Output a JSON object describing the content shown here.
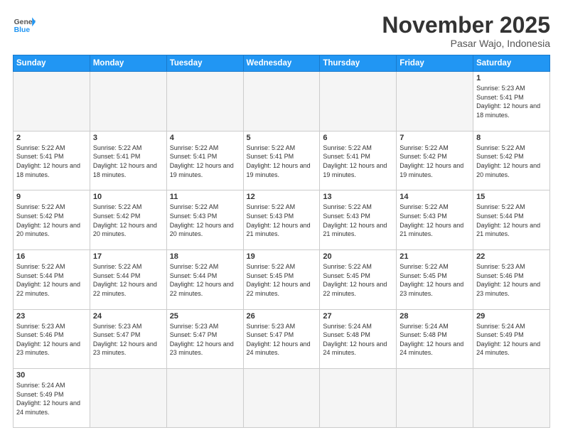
{
  "header": {
    "logo_general": "General",
    "logo_blue": "Blue",
    "month_title": "November 2025",
    "location": "Pasar Wajo, Indonesia"
  },
  "weekdays": [
    "Sunday",
    "Monday",
    "Tuesday",
    "Wednesday",
    "Thursday",
    "Friday",
    "Saturday"
  ],
  "rows": [
    [
      {
        "day": "",
        "info": ""
      },
      {
        "day": "",
        "info": ""
      },
      {
        "day": "",
        "info": ""
      },
      {
        "day": "",
        "info": ""
      },
      {
        "day": "",
        "info": ""
      },
      {
        "day": "",
        "info": ""
      },
      {
        "day": "1",
        "info": "Sunrise: 5:23 AM\nSunset: 5:41 PM\nDaylight: 12 hours and 18 minutes."
      }
    ],
    [
      {
        "day": "2",
        "info": "Sunrise: 5:22 AM\nSunset: 5:41 PM\nDaylight: 12 hours and 18 minutes."
      },
      {
        "day": "3",
        "info": "Sunrise: 5:22 AM\nSunset: 5:41 PM\nDaylight: 12 hours and 18 minutes."
      },
      {
        "day": "4",
        "info": "Sunrise: 5:22 AM\nSunset: 5:41 PM\nDaylight: 12 hours and 19 minutes."
      },
      {
        "day": "5",
        "info": "Sunrise: 5:22 AM\nSunset: 5:41 PM\nDaylight: 12 hours and 19 minutes."
      },
      {
        "day": "6",
        "info": "Sunrise: 5:22 AM\nSunset: 5:41 PM\nDaylight: 12 hours and 19 minutes."
      },
      {
        "day": "7",
        "info": "Sunrise: 5:22 AM\nSunset: 5:42 PM\nDaylight: 12 hours and 19 minutes."
      },
      {
        "day": "8",
        "info": "Sunrise: 5:22 AM\nSunset: 5:42 PM\nDaylight: 12 hours and 20 minutes."
      }
    ],
    [
      {
        "day": "9",
        "info": "Sunrise: 5:22 AM\nSunset: 5:42 PM\nDaylight: 12 hours and 20 minutes."
      },
      {
        "day": "10",
        "info": "Sunrise: 5:22 AM\nSunset: 5:42 PM\nDaylight: 12 hours and 20 minutes."
      },
      {
        "day": "11",
        "info": "Sunrise: 5:22 AM\nSunset: 5:43 PM\nDaylight: 12 hours and 20 minutes."
      },
      {
        "day": "12",
        "info": "Sunrise: 5:22 AM\nSunset: 5:43 PM\nDaylight: 12 hours and 21 minutes."
      },
      {
        "day": "13",
        "info": "Sunrise: 5:22 AM\nSunset: 5:43 PM\nDaylight: 12 hours and 21 minutes."
      },
      {
        "day": "14",
        "info": "Sunrise: 5:22 AM\nSunset: 5:43 PM\nDaylight: 12 hours and 21 minutes."
      },
      {
        "day": "15",
        "info": "Sunrise: 5:22 AM\nSunset: 5:44 PM\nDaylight: 12 hours and 21 minutes."
      }
    ],
    [
      {
        "day": "16",
        "info": "Sunrise: 5:22 AM\nSunset: 5:44 PM\nDaylight: 12 hours and 22 minutes."
      },
      {
        "day": "17",
        "info": "Sunrise: 5:22 AM\nSunset: 5:44 PM\nDaylight: 12 hours and 22 minutes."
      },
      {
        "day": "18",
        "info": "Sunrise: 5:22 AM\nSunset: 5:44 PM\nDaylight: 12 hours and 22 minutes."
      },
      {
        "day": "19",
        "info": "Sunrise: 5:22 AM\nSunset: 5:45 PM\nDaylight: 12 hours and 22 minutes."
      },
      {
        "day": "20",
        "info": "Sunrise: 5:22 AM\nSunset: 5:45 PM\nDaylight: 12 hours and 22 minutes."
      },
      {
        "day": "21",
        "info": "Sunrise: 5:22 AM\nSunset: 5:45 PM\nDaylight: 12 hours and 23 minutes."
      },
      {
        "day": "22",
        "info": "Sunrise: 5:23 AM\nSunset: 5:46 PM\nDaylight: 12 hours and 23 minutes."
      }
    ],
    [
      {
        "day": "23",
        "info": "Sunrise: 5:23 AM\nSunset: 5:46 PM\nDaylight: 12 hours and 23 minutes."
      },
      {
        "day": "24",
        "info": "Sunrise: 5:23 AM\nSunset: 5:47 PM\nDaylight: 12 hours and 23 minutes."
      },
      {
        "day": "25",
        "info": "Sunrise: 5:23 AM\nSunset: 5:47 PM\nDaylight: 12 hours and 23 minutes."
      },
      {
        "day": "26",
        "info": "Sunrise: 5:23 AM\nSunset: 5:47 PM\nDaylight: 12 hours and 24 minutes."
      },
      {
        "day": "27",
        "info": "Sunrise: 5:24 AM\nSunset: 5:48 PM\nDaylight: 12 hours and 24 minutes."
      },
      {
        "day": "28",
        "info": "Sunrise: 5:24 AM\nSunset: 5:48 PM\nDaylight: 12 hours and 24 minutes."
      },
      {
        "day": "29",
        "info": "Sunrise: 5:24 AM\nSunset: 5:49 PM\nDaylight: 12 hours and 24 minutes."
      }
    ],
    [
      {
        "day": "30",
        "info": "Sunrise: 5:24 AM\nSunset: 5:49 PM\nDaylight: 12 hours and 24 minutes."
      },
      {
        "day": "",
        "info": ""
      },
      {
        "day": "",
        "info": ""
      },
      {
        "day": "",
        "info": ""
      },
      {
        "day": "",
        "info": ""
      },
      {
        "day": "",
        "info": ""
      },
      {
        "day": "",
        "info": ""
      }
    ]
  ]
}
